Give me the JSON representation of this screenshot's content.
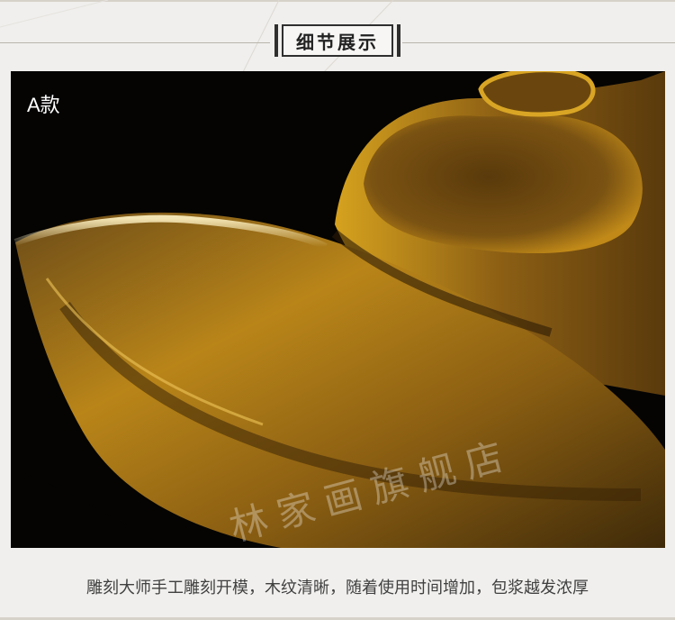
{
  "header": {
    "title": "细节展示"
  },
  "photo": {
    "variant_label": "A款",
    "watermark": "林家画旗舰店"
  },
  "caption": "雕刻大师手工雕刻开模，木纹清晰，随着使用时间增加，包浆越发浓厚"
}
